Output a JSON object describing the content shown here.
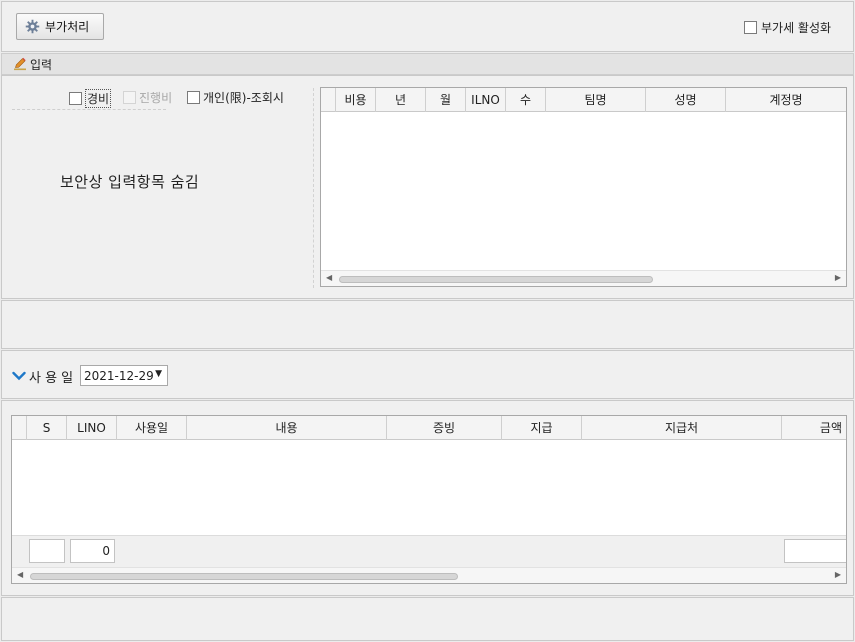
{
  "toolbar": {
    "extra_button_label": "부가처리",
    "vat_toggle_label": "부가세 활성화"
  },
  "input_section": {
    "title": "입력",
    "checkbox_expense": "경비",
    "checkbox_progress": "진행비",
    "checkbox_personal": "개인(限)-조회시",
    "security_notice": "보안상 입력항목 숨김",
    "grid_columns": [
      "",
      "비용",
      "년",
      "월",
      "ILNO",
      "수",
      "팀명",
      "성명",
      "계정명"
    ]
  },
  "date_filter": {
    "label": "사 용 일",
    "value": "2021-12-29"
  },
  "detail_grid": {
    "columns": [
      "",
      "S",
      "LINO",
      "사용일",
      "내용",
      "증빙",
      "지급",
      "지급처",
      "금액"
    ],
    "footer_count": "0"
  },
  "icons": {
    "gear": "gear-icon",
    "pencil": "pencil-icon",
    "collapse": "chevron-down-icon"
  },
  "colors": {
    "accent": "#1e78c8",
    "panel_bg": "#f0f0f0",
    "border": "#c9c9c9"
  }
}
